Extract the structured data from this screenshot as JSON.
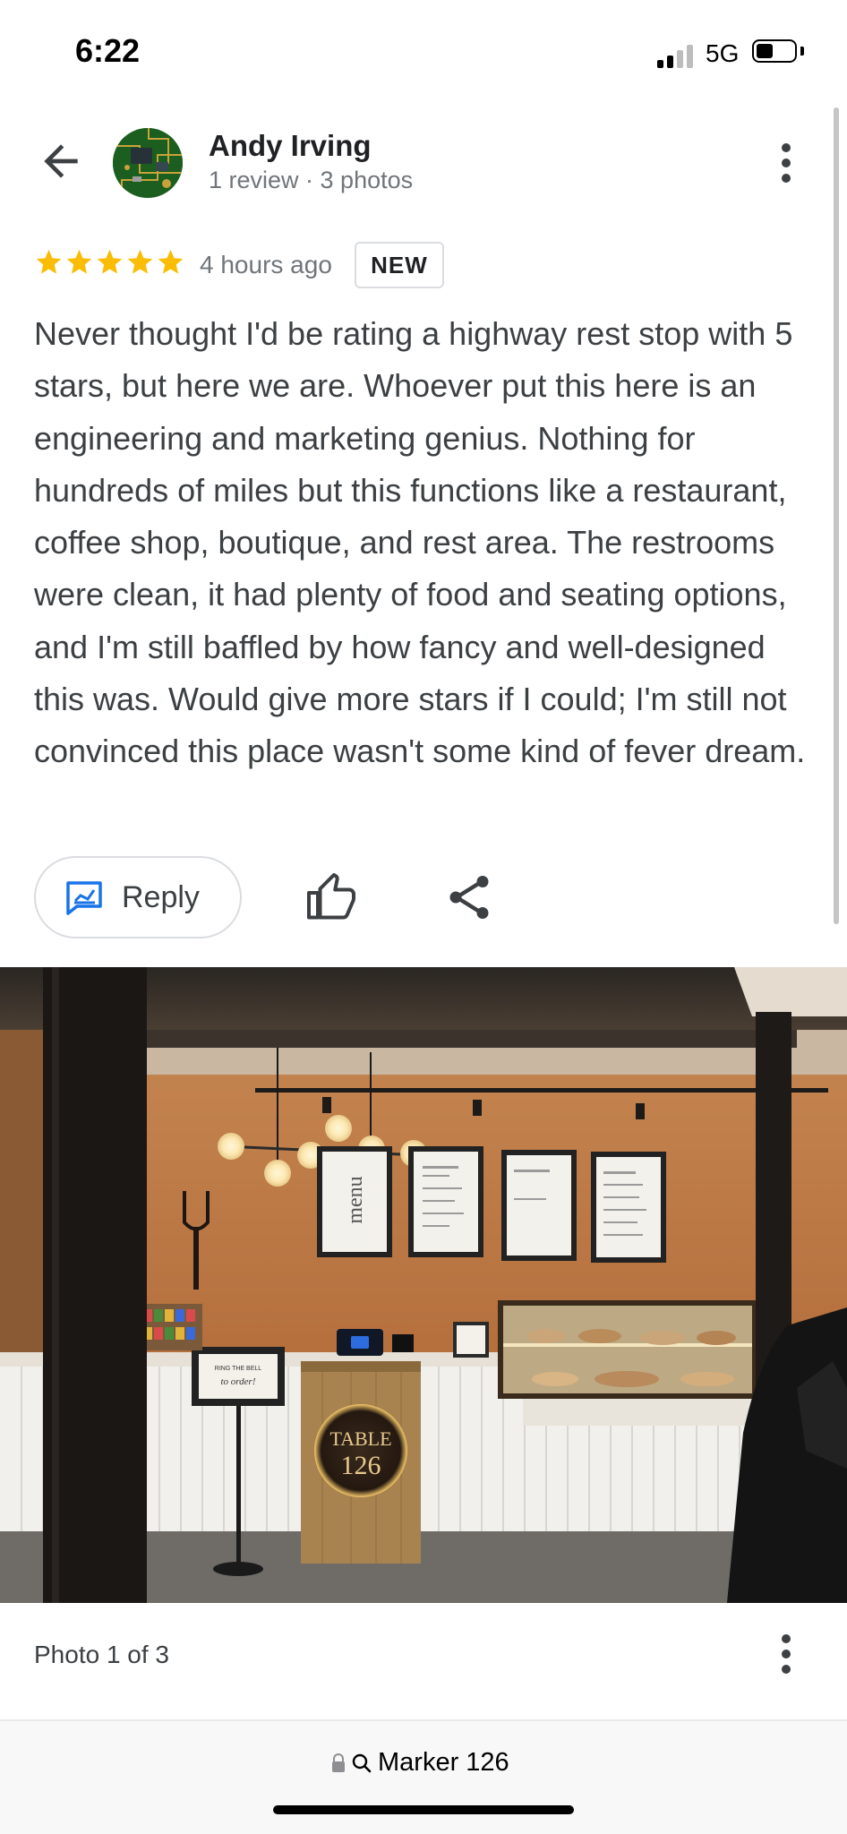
{
  "status_bar": {
    "time": "6:22",
    "network": "5G"
  },
  "reviewer": {
    "name": "Andy Irving",
    "meta": "1 review · 3 photos"
  },
  "review": {
    "rating": 5,
    "max_rating": 5,
    "time_ago": "4 hours ago",
    "badge": "NEW",
    "text": "Never thought I'd be rating a highway rest stop with 5 stars, but here we are. Whoever put this here is an engineering and marketing genius. Nothing for hundreds of miles but this functions like a restaurant, coffee shop, boutique, and rest area. The restrooms were clean, it had plenty of food and seating options, and I'm still baffled by how fancy and well-designed this was. Would give more stars if I could; I'm still not convinced this place wasn't some kind of fever dream."
  },
  "actions": {
    "reply_label": "Reply"
  },
  "photo": {
    "caption": "Photo 1 of 3",
    "menu_boards": [
      "menu"
    ],
    "stand_text": "TABLE 126",
    "sign_text": "RING THE BELL to order!"
  },
  "browser": {
    "url_text": "Marker 126"
  },
  "colors": {
    "star": "#fbbc04",
    "reply_icon": "#1a73e8",
    "text_primary": "#202124",
    "text_secondary": "#70757a"
  }
}
